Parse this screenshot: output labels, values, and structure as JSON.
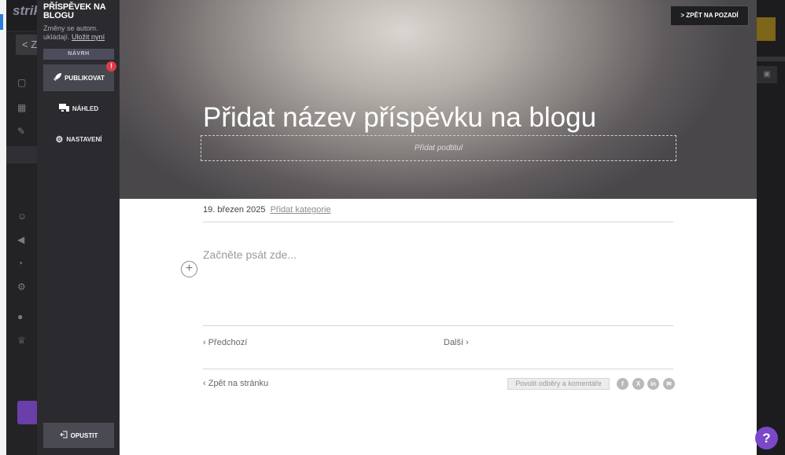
{
  "background_app": {
    "logo": "strik",
    "back_label": "< Z"
  },
  "panel": {
    "title": "PŘÍSPĚVEK NA BLOGU",
    "autosave_text": "Změny se autom. ukládají.",
    "save_now_link": "Uložit nyní",
    "status_badge": "NÁVRH",
    "publish_label": "PUBLIKOVAT",
    "alert_count": "!",
    "preview_label": "NÁHLED",
    "settings_label": "NASTAVENÍ",
    "leave_label": "OPUSTIT"
  },
  "hero": {
    "back_to_bg_button": "> ZPĚT NA POZADÍ",
    "title_placeholder": "Přidat název příspěvku na blogu",
    "subtitle_placeholder": "Přidat podtitul"
  },
  "post": {
    "date": "19. březen 2025",
    "add_categories_link": "Přidat kategorie",
    "body_placeholder": "Začněte psát zde...",
    "add_block_symbol": "+",
    "prev_link": "‹ Předchozí",
    "next_link": "Další ›",
    "back_link": "‹ Zpět na stránku",
    "comments_button": "Povolit odběry a komentáře",
    "social_icons": [
      "facebook-icon",
      "x-twitter-icon",
      "linkedin-icon",
      "email-icon"
    ]
  },
  "help": {
    "label": "?"
  },
  "colors": {
    "panel_bg": "#2b2b2f",
    "accent_purple": "#7b48c9",
    "alert_red": "#e03a4a"
  }
}
